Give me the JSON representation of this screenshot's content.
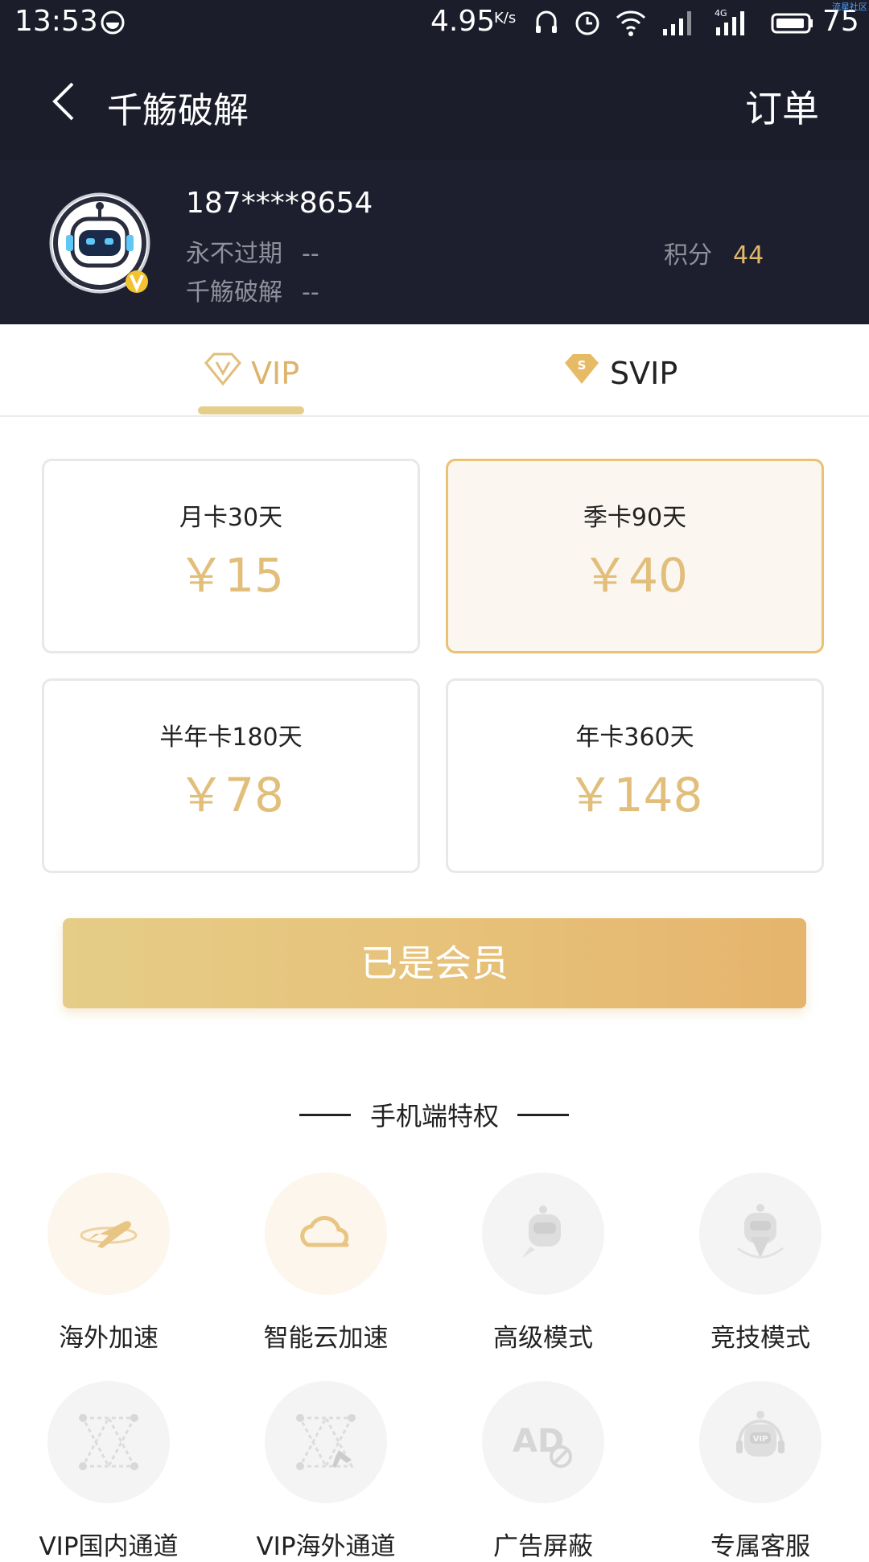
{
  "status_bar": {
    "time": "13:53",
    "net_speed": "4.95",
    "net_speed_unit": "K/s",
    "battery": "75",
    "watermark": "流星社区"
  },
  "header": {
    "title": "千觞破解",
    "orders_label": "订单"
  },
  "user": {
    "phone": "187****8654",
    "row1_label": "永不过期",
    "row1_value": "--",
    "row2_label": "千觞破解",
    "row2_value": "--",
    "points_label": "积分",
    "points_value": "44"
  },
  "tabs": [
    {
      "label": "VIP",
      "active": true
    },
    {
      "label": "SVIP",
      "active": false
    }
  ],
  "plans": [
    {
      "name": "月卡30天",
      "price": "￥15",
      "selected": false
    },
    {
      "name": "季卡90天",
      "price": "￥40",
      "selected": true
    },
    {
      "name": "半年卡180天",
      "price": "￥78",
      "selected": false
    },
    {
      "name": "年卡360天",
      "price": "￥148",
      "selected": false
    }
  ],
  "primary_button": "已是会员",
  "privileges": {
    "title": "手机端特权",
    "items": [
      {
        "label": "海外加速",
        "icon": "airplane-icon",
        "active": true
      },
      {
        "label": "智能云加速",
        "icon": "cloud-icon",
        "active": true
      },
      {
        "label": "高级模式",
        "icon": "robot-icon",
        "active": false
      },
      {
        "label": "竞技模式",
        "icon": "robot-shield-icon",
        "active": false
      },
      {
        "label": "VIP国内通道",
        "icon": "network-icon",
        "active": false
      },
      {
        "label": "VIP海外通道",
        "icon": "network-plane-icon",
        "active": false
      },
      {
        "label": "广告屏蔽",
        "icon": "ad-block-icon",
        "active": false
      },
      {
        "label": "专属客服",
        "icon": "vip-robot-icon",
        "active": false
      }
    ]
  },
  "colors": {
    "dark_header": "#1b1d2b",
    "gold": "#e2be7b",
    "selected_border": "#e9c273"
  }
}
